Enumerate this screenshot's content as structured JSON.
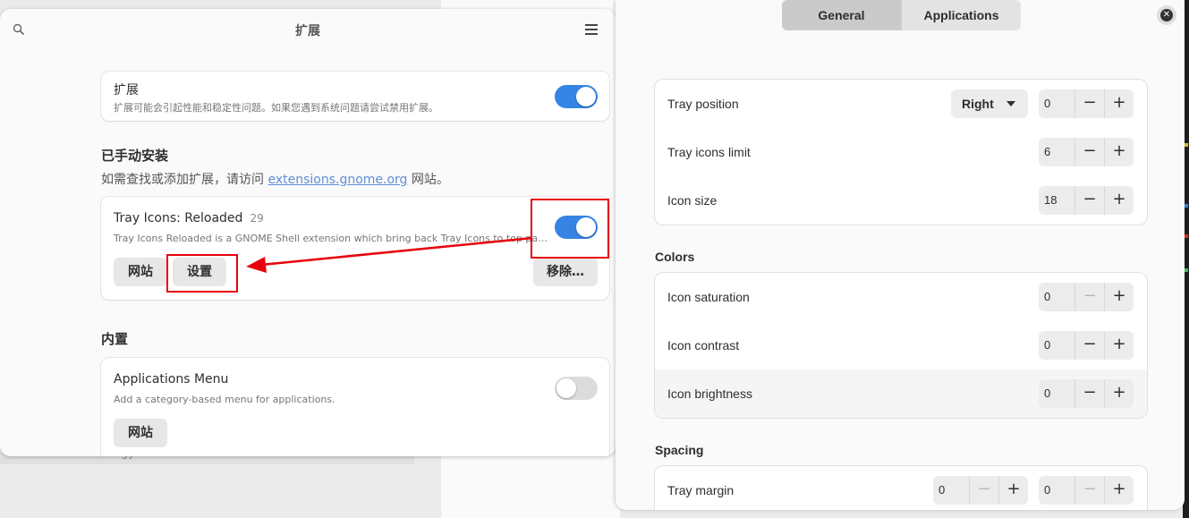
{
  "extensions_window": {
    "title": "扩展",
    "main_toggle": {
      "title": "扩展",
      "subtitle": "扩展可能会引起性能和稳定性问题。如果您遇到系统问题请尝试禁用扩展。",
      "enabled": true
    },
    "manual_section": {
      "heading": "已手动安装",
      "hint_prefix": "如需查找或添加扩展，请访问",
      "hint_link": "extensions.gnome.org",
      "hint_suffix": "网站。"
    },
    "installed_extension": {
      "name": "Tray Icons: Reloaded",
      "version": "29",
      "description": "Tray Icons Reloaded is a GNOME Shell extension which bring back Tray Icons to top panel, with …",
      "enabled": true,
      "website_label": "网站",
      "settings_label": "设置",
      "remove_label": "移除…"
    },
    "builtin_section": {
      "heading": "内置"
    },
    "builtin_extension": {
      "name": "Applications Menu",
      "description": "Add a category-based menu for applications.",
      "enabled": false,
      "website_label": "网站"
    },
    "partial_text": "gy"
  },
  "prefs_window": {
    "tabs": [
      {
        "label": "General",
        "active": true
      },
      {
        "label": "Applications",
        "active": false
      }
    ],
    "close_icon": "close-icon",
    "general_group": {
      "rows": [
        {
          "label": "Tray position",
          "dropdown": "Right",
          "value": "0"
        },
        {
          "label": "Tray icons limit",
          "value": "6"
        },
        {
          "label": "Icon size",
          "value": "18"
        }
      ]
    },
    "colors_group": {
      "title": "Colors",
      "rows": [
        {
          "label": "Icon saturation",
          "value": "0",
          "minus_disabled": true
        },
        {
          "label": "Icon contrast",
          "value": "0"
        },
        {
          "label": "Icon brightness",
          "value": "0",
          "highlighted": true
        }
      ]
    },
    "spacing_group": {
      "title": "Spacing",
      "rows": [
        {
          "label": "Tray margin",
          "value_left": "0",
          "value_right": "0"
        }
      ]
    },
    "spin_minus": "−",
    "spin_plus": "+"
  },
  "colors": {
    "accent": "#3584e4",
    "annotation_red": "#e8000c",
    "link": "#5e8ed8"
  }
}
